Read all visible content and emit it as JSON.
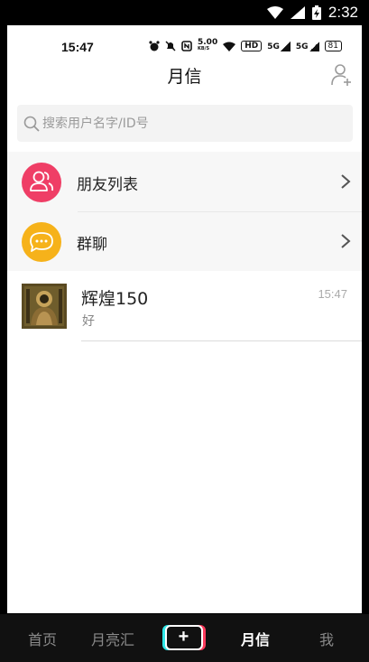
{
  "system_status": {
    "time": "2:32"
  },
  "app_status": {
    "time": "15:47",
    "network_speed": "5.00",
    "network_unit": "KB/S",
    "hd": "HD",
    "signal_1": "5G",
    "signal_2": "5G",
    "battery": "81"
  },
  "header": {
    "title": "月信"
  },
  "search": {
    "placeholder": "搜索用户名字/ID号"
  },
  "menu": [
    {
      "label": "朋友列表",
      "icon": "friends-icon",
      "color": "#ef3e66"
    },
    {
      "label": "群聊",
      "icon": "group-chat-icon",
      "color": "#f6b21a"
    }
  ],
  "chats": [
    {
      "name": "辉煌150",
      "preview": "好",
      "time": "15:47"
    }
  ],
  "tabs": [
    {
      "label": "首页",
      "active": false
    },
    {
      "label": "月亮汇",
      "active": false
    },
    {
      "label": "+",
      "active": false
    },
    {
      "label": "月信",
      "active": true
    },
    {
      "label": "我",
      "active": false
    }
  ]
}
